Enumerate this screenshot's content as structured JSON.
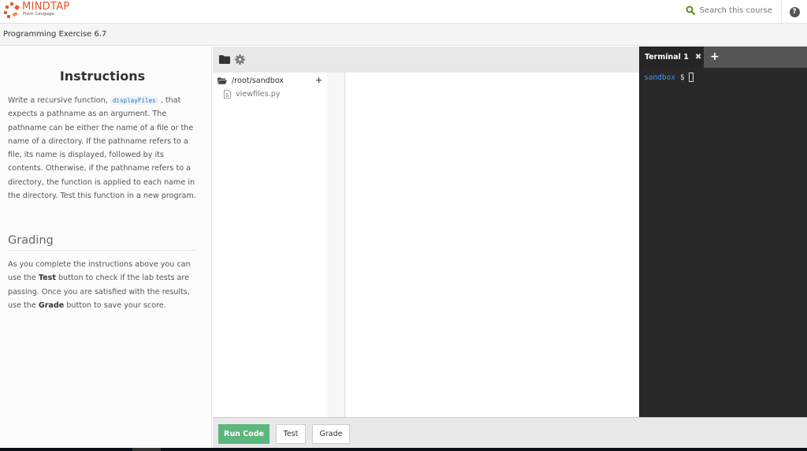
{
  "header": {
    "logo_title": "MINDTAP",
    "logo_subtitle": "From Cengage",
    "search_placeholder": "Search this course",
    "help_label": "?"
  },
  "subheader": {
    "title": "Programming Exercise 6.7"
  },
  "instructions": {
    "heading": "Instructions",
    "text_before": "Write a recursive function, ",
    "code": "displayFiles",
    "text_after": " , that expects a pathname as an argument. The pathname can be either the name of a file or the name of a directory. If the pathname refers to a file, its name is displayed, followed by its contents. Otherwise, if the pathname refers to a directory, the function is applied to each name in the directory. Test this function in a new program."
  },
  "grading": {
    "heading": "Grading",
    "part1": "As you complete the instructions above you can use the ",
    "bold1": "Test",
    "part2": " button to check if the lab tests are passing. Once you are satisfied with the results, use the ",
    "bold2": "Grade",
    "part3": " button to save your score."
  },
  "file_tree": {
    "root": "/root/sandbox",
    "add_label": "+",
    "files": [
      "viewfiles.py"
    ]
  },
  "terminal": {
    "tab_label": "Terminal 1",
    "close_label": "✖",
    "add_label": "+",
    "prompt_host": "sandbox",
    "prompt_sign": "$"
  },
  "actions": {
    "run_label": "Run Code",
    "test_label": "Test",
    "grade_label": "Grade"
  },
  "colors": {
    "brand": "#e8542a",
    "run_button": "#5cb67d",
    "terminal_bg": "#282828",
    "prompt": "#4a90e2"
  }
}
